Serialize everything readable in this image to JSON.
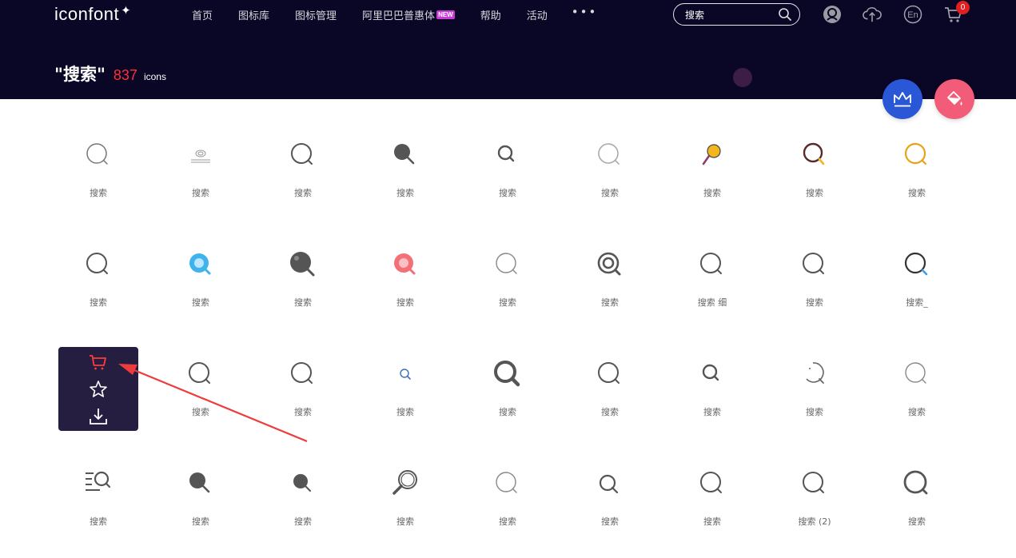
{
  "header": {
    "logo": "iconfont",
    "nav": [
      {
        "label": "首页"
      },
      {
        "label": "图标库"
      },
      {
        "label": "图标管理"
      },
      {
        "label": "阿里巴巴普惠体",
        "badge": "NEW"
      },
      {
        "label": "帮助"
      },
      {
        "label": "活动"
      }
    ],
    "more": "•••",
    "search_value": "搜索",
    "lang": "En",
    "cart_count": "0"
  },
  "result": {
    "query": "\"搜索\"",
    "count": "837",
    "unit": "icons"
  },
  "icons": [
    {
      "label": "搜索",
      "icon": "search-outline-thin-icon"
    },
    {
      "label": "搜索",
      "icon": "search-underline-icon"
    },
    {
      "label": "搜索",
      "icon": "search-outline-icon"
    },
    {
      "label": "搜索",
      "icon": "search-filled-icon"
    },
    {
      "label": "搜索",
      "icon": "search-small-icon"
    },
    {
      "label": "搜索",
      "icon": "search-light-icon"
    },
    {
      "label": "搜索",
      "icon": "search-yellow-icon"
    },
    {
      "label": "搜索",
      "icon": "search-brown-yellow-icon"
    },
    {
      "label": "搜索",
      "icon": "search-orange-icon"
    },
    {
      "label": "搜索",
      "icon": "search-outline-icon"
    },
    {
      "label": "搜索",
      "icon": "search-blue-icon"
    },
    {
      "label": "搜索",
      "icon": "search-dark-filled-icon"
    },
    {
      "label": "搜索",
      "icon": "search-pink-icon"
    },
    {
      "label": "搜索",
      "icon": "search-thin-icon"
    },
    {
      "label": "搜索",
      "icon": "search-target-icon"
    },
    {
      "label": "搜索 细",
      "icon": "search-outline-icon"
    },
    {
      "label": "搜索",
      "icon": "search-outline-icon"
    },
    {
      "label": "搜索_",
      "icon": "search-blue-handle-icon"
    },
    {
      "label": "",
      "icon": "search-outline-icon"
    },
    {
      "label": "搜索",
      "icon": "search-outline-icon"
    },
    {
      "label": "搜索",
      "icon": "search-outline-icon"
    },
    {
      "label": "搜索",
      "icon": "search-tiny-blue-icon"
    },
    {
      "label": "搜索",
      "icon": "search-bold-icon"
    },
    {
      "label": "搜索",
      "icon": "search-outline-icon"
    },
    {
      "label": "搜索",
      "icon": "search-small-icon"
    },
    {
      "label": "搜索",
      "icon": "search-arc-icon"
    },
    {
      "label": "搜索",
      "icon": "search-thin-icon"
    },
    {
      "label": "搜索",
      "icon": "search-list-icon"
    },
    {
      "label": "搜索",
      "icon": "search-filled-icon"
    },
    {
      "label": "搜索",
      "icon": "search-filled-small-icon"
    },
    {
      "label": "搜索",
      "icon": "search-magnifier-icon"
    },
    {
      "label": "搜索",
      "icon": "search-thin-icon"
    },
    {
      "label": "搜索",
      "icon": "search-reversed-icon"
    },
    {
      "label": "搜索",
      "icon": "search-outline-icon"
    },
    {
      "label": "搜索 (2)",
      "icon": "search-outline-icon"
    },
    {
      "label": "搜索",
      "icon": "search-bold-outline-icon"
    }
  ],
  "colors": {
    "header_bg": "#0a0625",
    "accent_red": "#ff2e38",
    "overlay_bg": "#251e41",
    "arrow": "#ee3b3b"
  }
}
